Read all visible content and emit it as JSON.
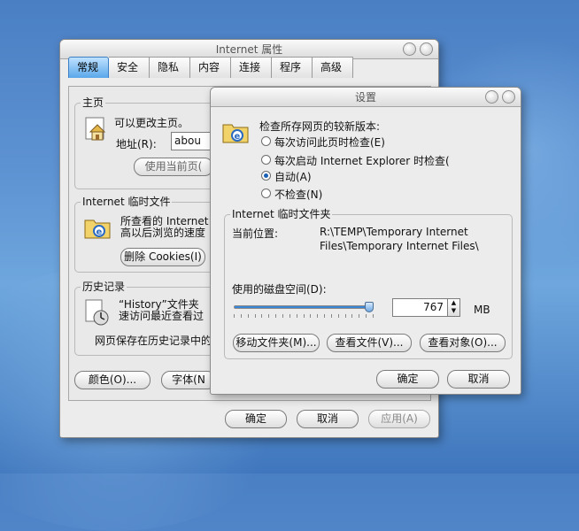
{
  "main_dialog": {
    "title": "Internet 属性",
    "tabs": [
      "常规",
      "安全",
      "隐私",
      "内容",
      "连接",
      "程序",
      "高级"
    ],
    "homepage": {
      "group_label": "主页",
      "description": "可以更改主页。",
      "address_label": "地址(R):",
      "address_value": "abou",
      "use_current_button": "使用当前页("
    },
    "temp_files": {
      "group_label": "Internet 临时文件",
      "desc_line1": "所查看的 Internet",
      "desc_line2": "高以后浏览的速度",
      "delete_cookies_button": "删除 Cookies(I)"
    },
    "history": {
      "group_label": "历史记录",
      "desc_line1": "“History”文件夹",
      "desc_line2": "速访问最近查看过",
      "keep_days_text": "网页保存在历史记录中的"
    },
    "colors_button": "颜色(O)...",
    "fonts_button": "字体(N",
    "ok_button": "确定",
    "cancel_button": "取消",
    "apply_button": "应用(A)"
  },
  "settings_dialog": {
    "title": "设置",
    "check_label": "检查所存网页的较新版本:",
    "options": [
      "每次访问此页时检查(E)",
      "每次启动 Internet Explorer 时检查(",
      "自动(A)",
      "不检查(N)"
    ],
    "selected_option": "自动(A)",
    "temp_folder": {
      "group_label": "Internet 临时文件夹",
      "location_label": "当前位置:",
      "location_line1": "R:\\TEMP\\Temporary Internet",
      "location_line2": "Files\\Temporary Internet Files\\",
      "disk_space_label": "使用的磁盘空间(D):",
      "disk_space_value": "767",
      "disk_space_unit": "MB",
      "slider_level_fraction": 1.0
    },
    "move_folder_button": "移动文件夹(M)...",
    "view_files_button": "查看文件(V)...",
    "view_objects_button": "查看对象(O)...",
    "ok_button": "确定",
    "cancel_button": "取消"
  }
}
